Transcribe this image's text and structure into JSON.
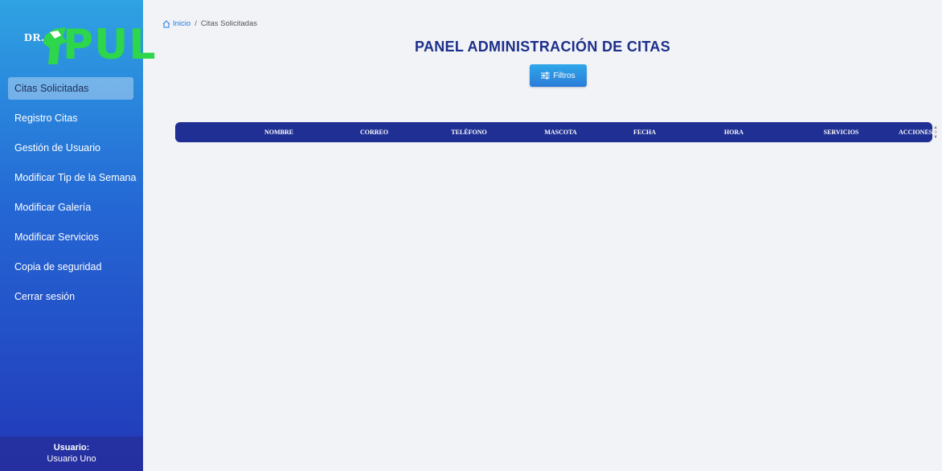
{
  "logo": {
    "prefix": "DR.",
    "name": "PUL"
  },
  "sidebar": {
    "items": [
      {
        "label": "Citas Solicitadas",
        "active": true
      },
      {
        "label": "Registro Citas"
      },
      {
        "label": "Gestión de Usuario"
      },
      {
        "label": "Modificar Tip de la Semana"
      },
      {
        "label": "Modificar Galería"
      },
      {
        "label": "Modificar Servicios"
      },
      {
        "label": "Copia de seguridad"
      },
      {
        "label": "Cerrar sesión"
      }
    ],
    "user_label": "Usuario:",
    "user_name": "Usuario Uno"
  },
  "breadcrumb": {
    "home": "Inicio",
    "separator": "/",
    "current": "Citas Solicitadas"
  },
  "page": {
    "title": "PANEL ADMINISTRACIÓN DE CITAS",
    "filter_label": "Filtros"
  },
  "table": {
    "columns": [
      "NOMBRE",
      "CORREO",
      "TELÉFONO",
      "MASCOTA",
      "FECHA",
      "HORA",
      "SERVICIOS",
      "ACCIONES"
    ],
    "rows": []
  },
  "colors": {
    "sidebar_top": "#2fa3e3",
    "sidebar_bottom": "#2238b8",
    "brand_green": "#2dd64a",
    "title": "#1c2f8a",
    "table_header": "#1f2f93"
  }
}
